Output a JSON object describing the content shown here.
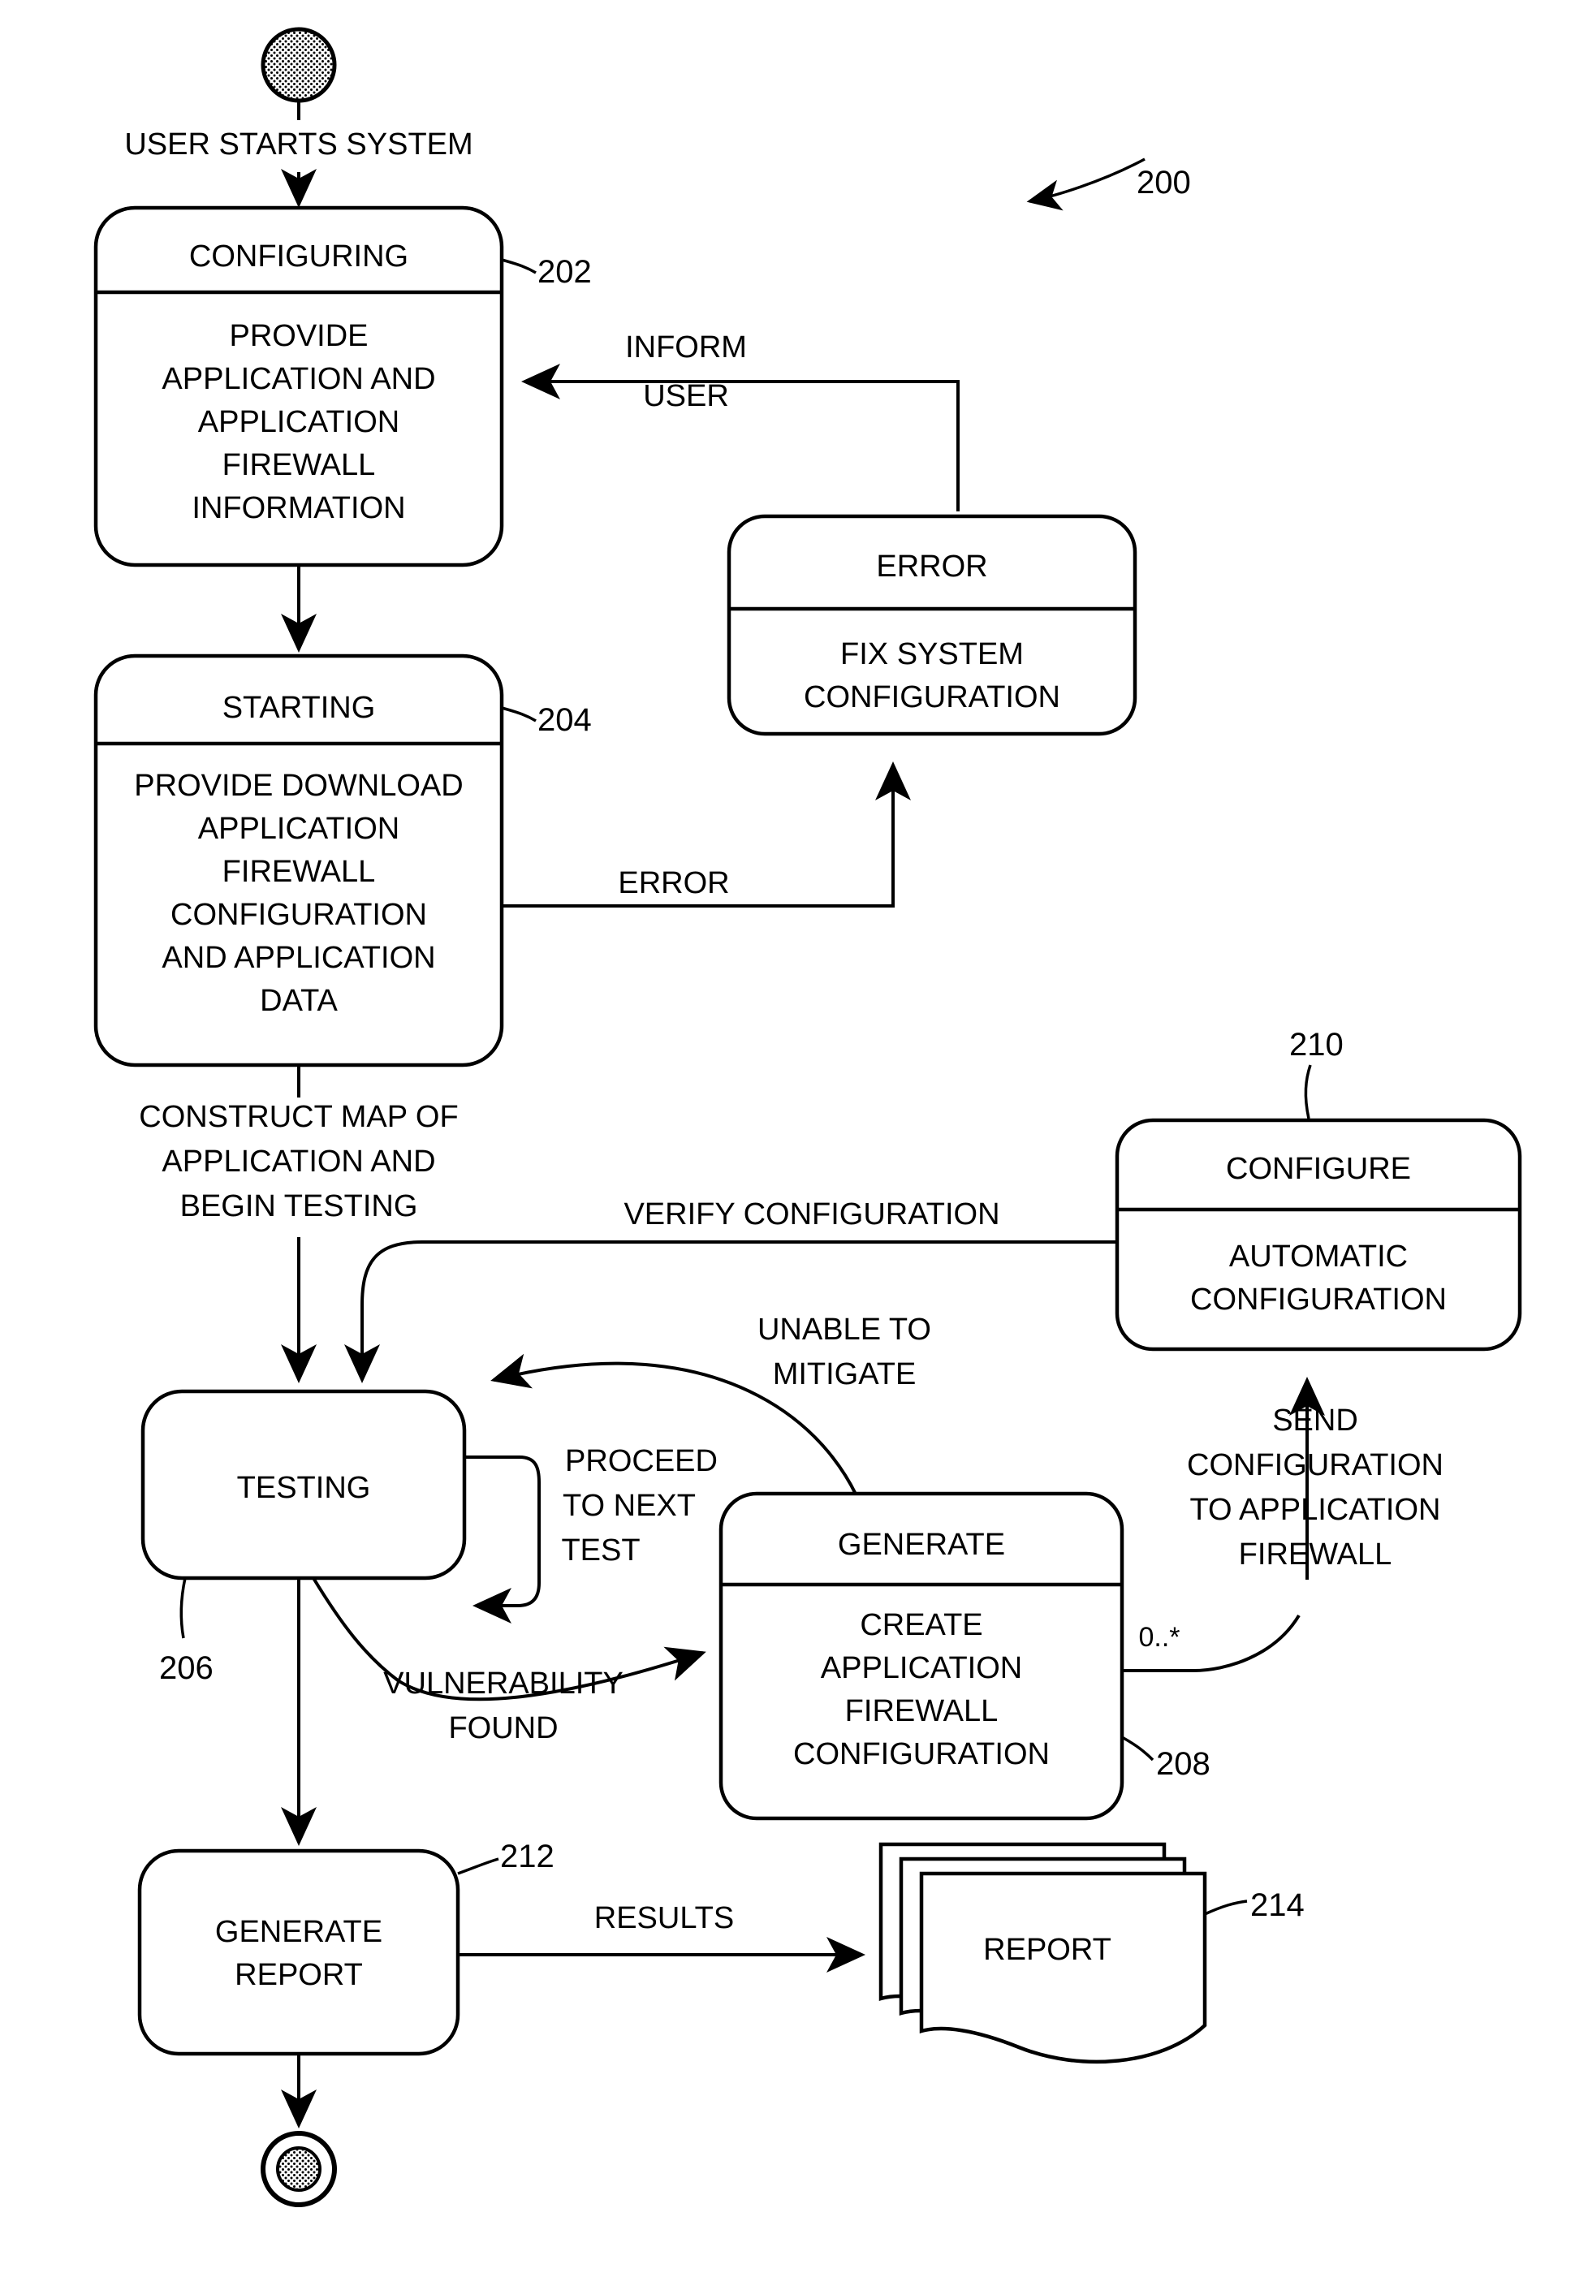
{
  "figure": {
    "number": "200",
    "type": "uml-state-diagram",
    "title_visible": false
  },
  "nodes": {
    "initial": {
      "name": "initial-state",
      "shape": "filled-circle"
    },
    "final": {
      "name": "final-state",
      "shape": "bullseye-circle"
    },
    "configuring": {
      "state": "CONFIGURING",
      "ref": "202",
      "body": [
        "PROVIDE",
        "APPLICATION AND",
        "APPLICATION",
        "FIREWALL",
        "INFORMATION"
      ]
    },
    "starting": {
      "state": "STARTING",
      "ref": "204",
      "body": [
        "PROVIDE DOWNLOAD",
        "APPLICATION",
        "FIREWALL",
        "CONFIGURATION",
        "AND APPLICATION",
        "DATA"
      ]
    },
    "error": {
      "state": "ERROR",
      "ref": "",
      "body": [
        "FIX SYSTEM",
        "CONFIGURATION"
      ]
    },
    "testing": {
      "state": "TESTING",
      "ref": "206",
      "body": []
    },
    "generate": {
      "state": "GENERATE",
      "ref": "208",
      "body": [
        "CREATE",
        "APPLICATION",
        "FIREWALL",
        "CONFIGURATION"
      ]
    },
    "configure": {
      "state": "CONFIGURE",
      "ref": "210",
      "body": [
        "AUTOMATIC",
        "CONFIGURATION"
      ]
    },
    "generate_report": {
      "state": "",
      "ref": "212",
      "body": [
        "GENERATE",
        "REPORT"
      ]
    },
    "report": {
      "state": "REPORT",
      "ref": "214",
      "body": []
    }
  },
  "transitions": {
    "user_starts_system": {
      "label": [
        "USER STARTS SYSTEM"
      ]
    },
    "inform_user": {
      "label": [
        "INFORM",
        "USER"
      ]
    },
    "error": {
      "label": [
        "ERROR"
      ]
    },
    "construct_map": {
      "label": [
        "CONSTRUCT MAP OF",
        "APPLICATION AND",
        "BEGIN TESTING"
      ]
    },
    "verify_configuration": {
      "label": [
        "VERIFY CONFIGURATION"
      ]
    },
    "unable_to_mitigate": {
      "label": [
        "UNABLE TO",
        "MITIGATE"
      ]
    },
    "proceed_to_next_test": {
      "label": [
        "PROCEED",
        "TO NEXT",
        "TEST"
      ]
    },
    "vulnerability_found": {
      "label": [
        "VULNERABILITY",
        "FOUND"
      ]
    },
    "send_configuration": {
      "label": [
        "SEND",
        "CONFIGURATION",
        "TO APPLICATION",
        "FIREWALL"
      ]
    },
    "results": {
      "label": [
        "RESULTS"
      ]
    },
    "multiplicity": {
      "label": [
        "0..*"
      ]
    }
  },
  "colors": {
    "stroke": "#000000",
    "fill": "#ffffff"
  }
}
